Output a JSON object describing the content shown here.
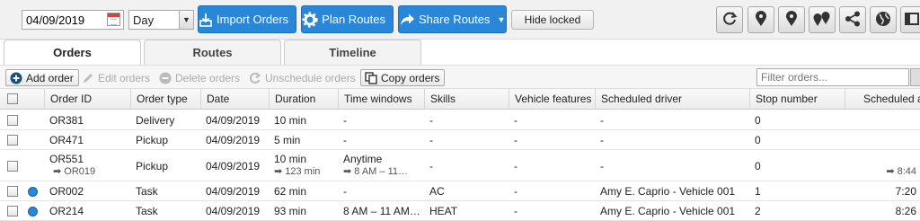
{
  "toolbar": {
    "date_value": "04/09/2019",
    "period_value": "Day",
    "import_label": "Import Orders",
    "plan_label": "Plan Routes",
    "share_label": "Share Routes",
    "hide_locked_label": "Hide locked"
  },
  "tabs": [
    {
      "label": "Orders"
    },
    {
      "label": "Routes"
    },
    {
      "label": "Timeline"
    }
  ],
  "actions": {
    "add_order": "Add order",
    "edit_orders": "Edit orders",
    "delete_orders": "Delete orders",
    "unschedule_orders": "Unschedule orders",
    "copy_orders": "Copy orders",
    "filter_placeholder": "Filter orders..."
  },
  "columns": [
    "Order ID",
    "Order type",
    "Date",
    "Duration",
    "Time windows",
    "Skills",
    "Vehicle features",
    "Scheduled driver",
    "Stop number",
    "Scheduled a"
  ],
  "rows": [
    {
      "id": "OR381",
      "id_sub": "",
      "type": "Delivery",
      "date": "04/09/2019",
      "duration": "10 min",
      "duration_sub": "",
      "tw": "-",
      "tw_sub": "",
      "skills": "-",
      "vf": "-",
      "driver": "-",
      "stop": "0",
      "sched": "",
      "sched_sub": "",
      "dot": false
    },
    {
      "id": "OR471",
      "id_sub": "",
      "type": "Pickup",
      "date": "04/09/2019",
      "duration": "5 min",
      "duration_sub": "",
      "tw": "-",
      "tw_sub": "",
      "skills": "-",
      "vf": "-",
      "driver": "-",
      "stop": "0",
      "sched": "",
      "sched_sub": "",
      "dot": false
    },
    {
      "id": "OR551",
      "id_sub": "➡ OR019",
      "type": "Pickup",
      "date": "04/09/2019",
      "duration": "10 min",
      "duration_sub": "➡ 123 min",
      "tw": "Anytime",
      "tw_sub": "➡ 8 AM – 11…",
      "skills": "-",
      "vf": "-",
      "driver": "-",
      "stop": "0",
      "sched": "",
      "sched_sub": "➡ 8:44",
      "dot": false
    },
    {
      "id": "OR002",
      "id_sub": "",
      "type": "Task",
      "date": "04/09/2019",
      "duration": "62 min",
      "duration_sub": "",
      "tw": "-",
      "tw_sub": "",
      "skills": "AC",
      "vf": "-",
      "driver": "Amy E. Caprio - Vehicle 001",
      "stop": "1",
      "sched": "7:20",
      "sched_sub": "",
      "dot": true
    },
    {
      "id": "OR214",
      "id_sub": "",
      "type": "Task",
      "date": "04/09/2019",
      "duration": "93 min",
      "duration_sub": "",
      "tw": "8 AM – 11 AM…",
      "tw_sub": "",
      "skills": "HEAT",
      "vf": "-",
      "driver": "Amy E. Caprio - Vehicle 001",
      "stop": "2",
      "sched": "8:26",
      "sched_sub": "",
      "dot": true
    }
  ]
}
